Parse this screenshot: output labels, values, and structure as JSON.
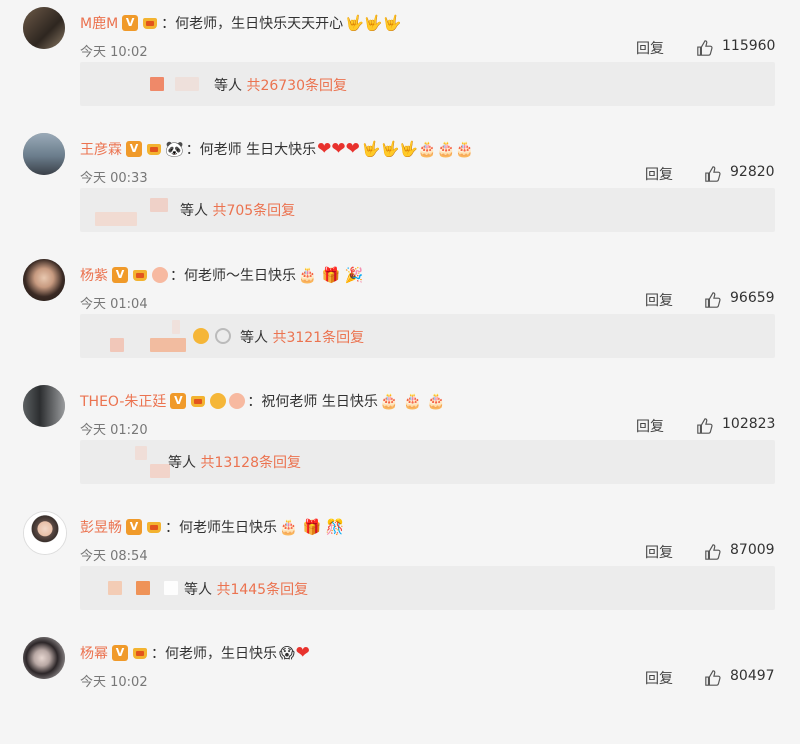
{
  "comments": [
    {
      "name": "M鹿M",
      "text": "：何老师，生日快乐天天开心",
      "emoji": "🤟🤟🤟",
      "emoji_red": "",
      "emoji_tail": "",
      "time": "今天 10:02",
      "reply": "回复",
      "likes": "115960",
      "sub_prefix": "等人",
      "sub_count": "共26730条回复"
    },
    {
      "name": "王彦霖",
      "text": "：何老师 生日大快乐",
      "emoji": "🐼",
      "emoji_red": "❤❤❤",
      "emoji_tail": "🤟🤟🤟🎂🎂🎂",
      "time": "今天 00:33",
      "reply": "回复",
      "likes": "92820",
      "sub_prefix": "等人",
      "sub_count": "共705条回复"
    },
    {
      "name": "杨紫",
      "text": "：何老师～生日快乐",
      "emoji": "",
      "emoji_red": "",
      "emoji_tail": "🎂 🎁 🎉",
      "time": "今天 01:04",
      "reply": "回复",
      "likes": "96659",
      "sub_prefix": "等人",
      "sub_count": "共3121条回复"
    },
    {
      "name": "THEO-朱正廷",
      "text": "：祝何老师 生日快乐",
      "emoji": "",
      "emoji_red": "",
      "emoji_tail": "🎂 🎂 🎂",
      "time": "今天 01:20",
      "reply": "回复",
      "likes": "102823",
      "sub_prefix": "等人",
      "sub_count": "共13128条回复"
    },
    {
      "name": "彭昱畅",
      "text": "：何老师生日快乐",
      "emoji": "",
      "emoji_red": "",
      "emoji_tail": "🎂 🎁 🎊",
      "time": "今天 08:54",
      "reply": "回复",
      "likes": "87009",
      "sub_prefix": "等人",
      "sub_count": "共1445条回复"
    },
    {
      "name": "杨幂",
      "text": "：何老师，生日快乐",
      "emoji": "😱",
      "emoji_red": "❤",
      "emoji_tail": "",
      "time": "今天 10:02",
      "reply": "回复",
      "likes": "80497",
      "sub_prefix": "",
      "sub_count": ""
    }
  ],
  "badges": {
    "verified": "V"
  },
  "colors": {
    "name": "#eb7350",
    "background": "#f5f5f5",
    "sub_box": "#ececec",
    "verified": "#f09a2a",
    "crown": "#f3b330"
  },
  "icons": {
    "like": "thumbs-up-icon",
    "verified": "verified-v-icon",
    "vip": "crown-icon"
  }
}
